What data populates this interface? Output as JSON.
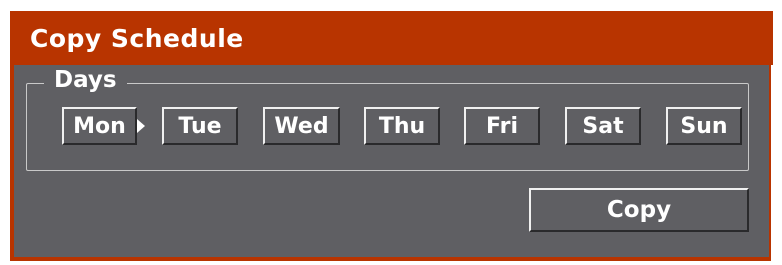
{
  "dialog": {
    "title": "Copy Schedule",
    "accent_color": "#b83400",
    "background_color": "#5f5f63"
  },
  "days_group": {
    "label": "Days",
    "source_day_index": 0,
    "days": [
      {
        "label": "Mon"
      },
      {
        "label": "Tue"
      },
      {
        "label": "Wed"
      },
      {
        "label": "Thu"
      },
      {
        "label": "Fri"
      },
      {
        "label": "Sat"
      },
      {
        "label": "Sun"
      }
    ]
  },
  "actions": {
    "copy_label": "Copy"
  },
  "icons": {
    "arrow": "caret-right-icon"
  }
}
